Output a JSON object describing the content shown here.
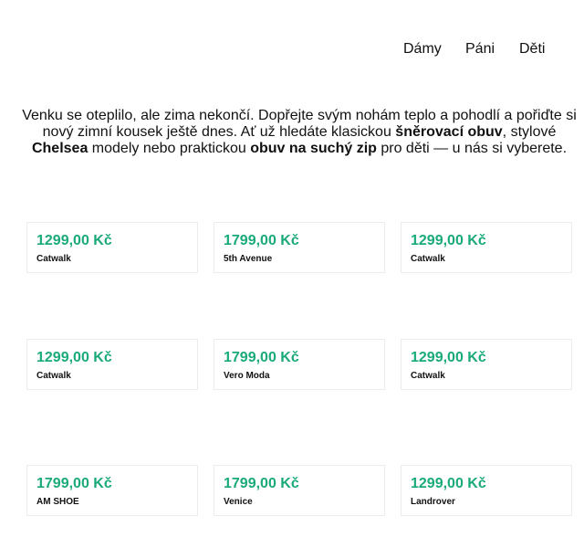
{
  "nav": {
    "items": [
      {
        "label": "Dámy"
      },
      {
        "label": "Páni"
      },
      {
        "label": "Děti"
      }
    ]
  },
  "intro": {
    "text_1": "Venku se oteplilo, ale zima nekončí. Dopřejte svým nohám teplo a pohodlí a pořiďte si nový zimní kousek ještě dnes. Ať už hledáte klasickou ",
    "link_1": "šněrovací obuv",
    "text_2": ", stylové ",
    "link_2": "Chelsea",
    "text_3": " modely nebo praktickou ",
    "link_3": "obuv na suchý zip",
    "text_4": " pro děti — u nás si vyberete."
  },
  "products": [
    {
      "price": "1299,00 Kč",
      "brand": "Catwalk"
    },
    {
      "price": "1799,00 Kč",
      "brand": "5th Avenue"
    },
    {
      "price": "1299,00 Kč",
      "brand": "Catwalk"
    },
    {
      "price": "1299,00 Kč",
      "brand": "Catwalk"
    },
    {
      "price": "1799,00 Kč",
      "brand": "Vero Moda"
    },
    {
      "price": "1299,00 Kč",
      "brand": "Catwalk"
    },
    {
      "price": "1799,00 Kč",
      "brand": "AM SHOE"
    },
    {
      "price": "1799,00 Kč",
      "brand": "Venice"
    },
    {
      "price": "1299,00 Kč",
      "brand": "Landrover"
    }
  ],
  "colors": {
    "price": "#1aaa7a",
    "card_border": "#ececec"
  }
}
